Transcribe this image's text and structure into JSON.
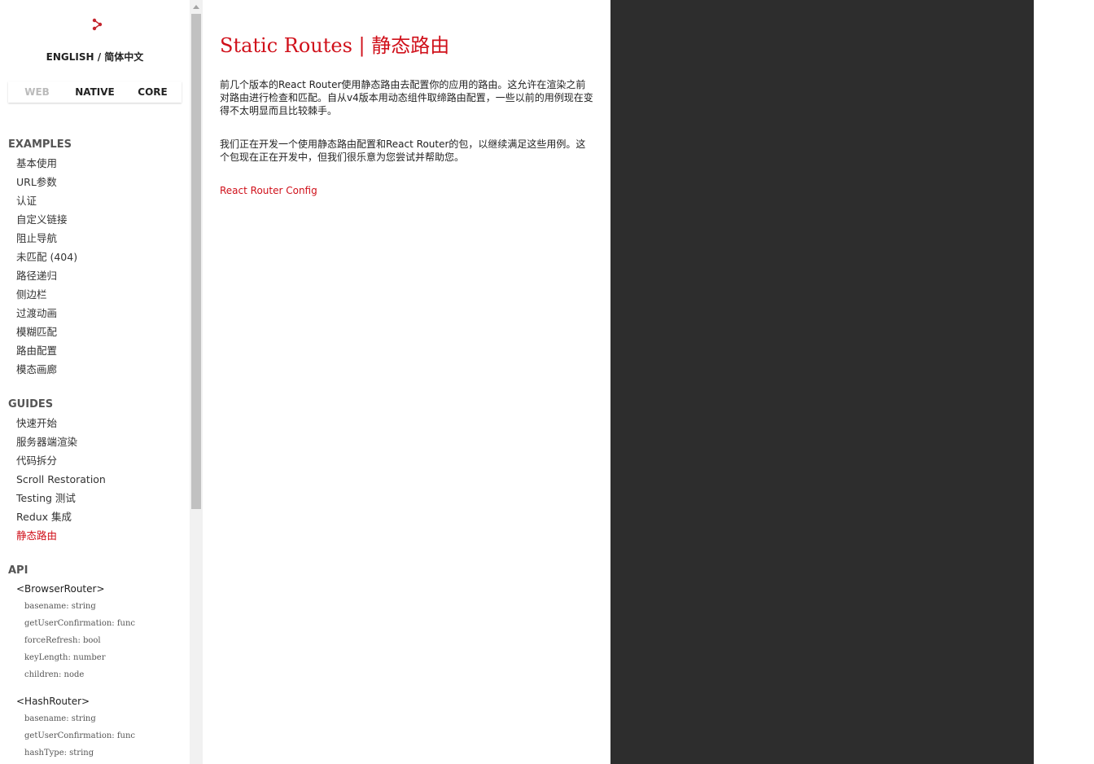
{
  "sidebar": {
    "language": "ENGLISH / 简体中文",
    "platform_tabs": [
      {
        "label": "WEB"
      },
      {
        "label": "NATIVE"
      },
      {
        "label": "CORE"
      }
    ],
    "examples": {
      "heading": "EXAMPLES",
      "items": [
        "基本使用",
        "URL参数",
        "认证",
        "自定义链接",
        "阻止导航",
        "未匹配 (404)",
        "路径递归",
        "侧边栏",
        "过渡动画",
        "模糊匹配",
        "路由配置",
        "模态画廊"
      ]
    },
    "guides": {
      "heading": "GUIDES",
      "items": [
        "快速开始",
        "服务器端渲染",
        "代码拆分",
        "Scroll Restoration",
        "Testing 测试",
        "Redux 集成",
        "静态路由"
      ],
      "active": "静态路由"
    },
    "api": {
      "heading": "API",
      "components": [
        {
          "name": "<BrowserRouter>",
          "props": [
            "basename: string",
            "getUserConfirmation: func",
            "forceRefresh: bool",
            "keyLength: number",
            "children: node"
          ]
        },
        {
          "name": "<HashRouter>",
          "props": [
            "basename: string",
            "getUserConfirmation: func",
            "hashType: string"
          ]
        }
      ]
    }
  },
  "main": {
    "title": "Static Routes | 静态路由",
    "paragraph1": "前几个版本的React Router使用静态路由去配置你的应用的路由。这允许在渲染之前对路由进行检查和匹配。自从v4版本用动态组件取缔路由配置，一些以前的用例现在变得不太明显而且比较棘手。",
    "paragraph2": "我们正在开发一个使用静态路由配置和React Router的包，以继续满足这些用例。这个包现在正在开发中，但我们很乐意为您尝试并帮助您。",
    "link": "React Router Config"
  },
  "colors": {
    "accent": "#d0101a",
    "dark_panel": "#2d2d2d"
  }
}
